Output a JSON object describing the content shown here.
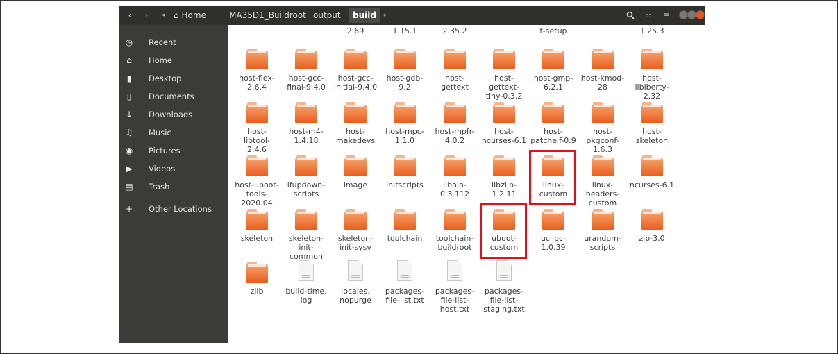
{
  "header": {
    "back_icon": "chevron-left-icon",
    "forward_icon": "chevron-right-icon",
    "crumb_prev_icon": "caret-left-icon",
    "home_icon": "home-icon",
    "crumbs": [
      "Home",
      "MA35D1_Buildroot",
      "output",
      "build"
    ],
    "crumb_next_icon": "caret-right-icon",
    "search_icon": "search-icon",
    "view_icon": "grid-view-icon",
    "menu_icon": "hamburger-menu-icon",
    "window_button_colors": [
      "#7a7874",
      "#7a7874",
      "#e95420"
    ]
  },
  "sidebar": {
    "items": [
      {
        "label": "Recent",
        "icon": "clock-icon"
      },
      {
        "label": "Home",
        "icon": "home-icon"
      },
      {
        "label": "Desktop",
        "icon": "folder-icon"
      },
      {
        "label": "Documents",
        "icon": "document-icon"
      },
      {
        "label": "Downloads",
        "icon": "download-arrow-icon"
      },
      {
        "label": "Music",
        "icon": "music-note-icon"
      },
      {
        "label": "Pictures",
        "icon": "camera-icon"
      },
      {
        "label": "Videos",
        "icon": "video-icon"
      },
      {
        "label": "Trash",
        "icon": "trash-icon"
      },
      {
        "label": "Other Locations",
        "icon": "plus-icon"
      }
    ]
  },
  "top_partial_labels": [
    "2.69",
    "1.15.1",
    "2.35.2",
    "t-setup",
    "1.25.3"
  ],
  "rows": [
    [
      {
        "type": "folder",
        "lines": [
          "host-flex-",
          "2.6.4"
        ]
      },
      {
        "type": "folder",
        "lines": [
          "host-gcc-",
          "final-9.4.0"
        ]
      },
      {
        "type": "folder",
        "lines": [
          "host-gcc-",
          "initial-9.4.0"
        ]
      },
      {
        "type": "folder",
        "lines": [
          "host-gdb-",
          "9.2"
        ]
      },
      {
        "type": "folder",
        "lines": [
          "host-",
          "gettext"
        ]
      },
      {
        "type": "folder",
        "lines": [
          "host-",
          "gettext-",
          "tiny-0.3.2"
        ]
      },
      {
        "type": "folder",
        "lines": [
          "host-gmp-",
          "6.2.1"
        ]
      },
      {
        "type": "folder",
        "lines": [
          "host-kmod-",
          "28"
        ]
      },
      {
        "type": "folder",
        "lines": [
          "host-",
          "libiberty-",
          "2.32"
        ]
      }
    ],
    [
      {
        "type": "folder",
        "lines": [
          "host-",
          "libtool-",
          "2.4.6"
        ]
      },
      {
        "type": "folder",
        "lines": [
          "host-m4-",
          "1.4.18"
        ]
      },
      {
        "type": "folder",
        "lines": [
          "host-",
          "makedevs"
        ]
      },
      {
        "type": "folder",
        "lines": [
          "host-mpc-",
          "1.1.0"
        ]
      },
      {
        "type": "folder",
        "lines": [
          "host-mpfr-",
          "4.0.2"
        ]
      },
      {
        "type": "folder",
        "lines": [
          "host-",
          "ncurses-6.1"
        ]
      },
      {
        "type": "folder",
        "lines": [
          "host-",
          "patchelf-0.9"
        ]
      },
      {
        "type": "folder",
        "lines": [
          "host-",
          "pkgconf-",
          "1.6.3"
        ]
      },
      {
        "type": "folder",
        "lines": [
          "host-",
          "skeleton"
        ]
      }
    ],
    [
      {
        "type": "folder",
        "lines": [
          "host-uboot-",
          "tools-",
          "2020.04"
        ]
      },
      {
        "type": "folder",
        "lines": [
          "ifupdown-",
          "scripts"
        ]
      },
      {
        "type": "folder",
        "lines": [
          "image"
        ]
      },
      {
        "type": "folder",
        "lines": [
          "initscripts"
        ]
      },
      {
        "type": "folder",
        "lines": [
          "libaio-",
          "0.3.112"
        ]
      },
      {
        "type": "folder",
        "lines": [
          "libzlib-",
          "1.2.11"
        ]
      },
      {
        "type": "folder",
        "lines": [
          "linux-",
          "custom"
        ],
        "highlight": true
      },
      {
        "type": "folder",
        "lines": [
          "linux-",
          "headers-",
          "custom"
        ]
      },
      {
        "type": "folder",
        "lines": [
          "ncurses-6.1"
        ]
      }
    ],
    [
      {
        "type": "folder",
        "lines": [
          "skeleton"
        ]
      },
      {
        "type": "folder",
        "lines": [
          "skeleton-",
          "init-",
          "common"
        ]
      },
      {
        "type": "folder",
        "lines": [
          "skeleton-",
          "init-sysv"
        ]
      },
      {
        "type": "folder",
        "lines": [
          "toolchain"
        ]
      },
      {
        "type": "folder",
        "lines": [
          "toolchain-",
          "buildroot"
        ]
      },
      {
        "type": "folder",
        "lines": [
          "uboot-",
          "custom"
        ],
        "highlight": true
      },
      {
        "type": "folder",
        "lines": [
          "uclibc-",
          "1.0.39"
        ]
      },
      {
        "type": "folder",
        "lines": [
          "urandom-",
          "scripts"
        ]
      },
      {
        "type": "folder",
        "lines": [
          "zip-3.0"
        ]
      }
    ],
    [
      {
        "type": "folder",
        "lines": [
          "zlib"
        ]
      },
      {
        "type": "file",
        "lines": [
          "build-time.",
          "log"
        ]
      },
      {
        "type": "file",
        "lines": [
          "locales.",
          "nopurge"
        ]
      },
      {
        "type": "file",
        "lines": [
          "packages-",
          "file-list.txt"
        ]
      },
      {
        "type": "file",
        "lines": [
          "packages-",
          "file-list-",
          "host.txt"
        ]
      },
      {
        "type": "file",
        "lines": [
          "packages-",
          "file-list-",
          "staging.txt"
        ]
      }
    ]
  ],
  "colors": {
    "highlight": "#e0101c",
    "folder_top": "#f59a62",
    "folder_bottom": "#e85e1e",
    "sidebar_bg": "#3c3b37",
    "header_bg": "#302f2c"
  }
}
